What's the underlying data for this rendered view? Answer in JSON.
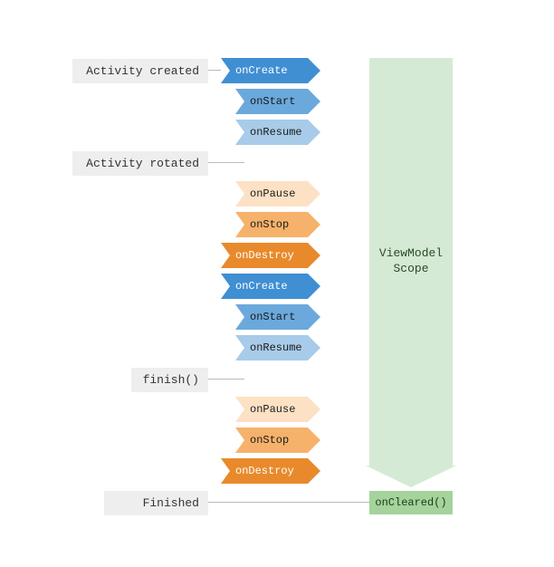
{
  "labels": {
    "created": "Activity created",
    "rotated": "Activity rotated",
    "finish": "finish()",
    "finished": "Finished"
  },
  "lifecycle": {
    "onCreate": "onCreate",
    "onStart": "onStart",
    "onResume": "onResume",
    "onPause": "onPause",
    "onStop": "onStop",
    "onDestroy": "onDestroy"
  },
  "viewmodel": {
    "scope": "ViewModel\nScope",
    "onCleared": "onCleared()"
  },
  "colors": {
    "blue1": "#3f8fd2",
    "blue2": "#6ba9dc",
    "blue3": "#a7cbe9",
    "orange1": "#fde1c4",
    "orange2": "#f6b26b",
    "orange3": "#e88a2c",
    "greenLight": "#d5ead4",
    "green": "#a4d39c",
    "labelBg": "#eeeeee"
  }
}
